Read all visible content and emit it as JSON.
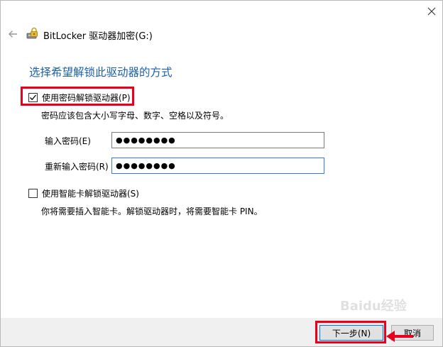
{
  "window": {
    "title": "BitLocker 驱动器加密(G:)"
  },
  "main": {
    "heading": "选择希望解锁此驱动器的方式",
    "password_option": {
      "label": "使用密码解锁驱动器(P)",
      "checked": true,
      "note": "密码应该包含大小写字母、数字、空格以及符号。",
      "enter_label": "输入密码(E)",
      "enter_value": "●●●●●●●●",
      "reenter_label": "重新输入密码(R)",
      "reenter_value": "●●●●●●●●"
    },
    "smartcard_option": {
      "label": "使用智能卡解锁驱动器(S)",
      "checked": false,
      "note": "你将需要插入智能卡。解锁驱动器时，将需要智能卡 PIN。"
    }
  },
  "footer": {
    "next_label": "下一步(N)",
    "cancel_label": "取消"
  },
  "watermark": {
    "text": "Baidu经验"
  },
  "colors": {
    "heading": "#1c5fa9",
    "highlight": "#e8001c",
    "focus_border": "#3a7bd5",
    "footer_bg": "#f0f0f0"
  },
  "icons": [
    "close-icon",
    "back-arrow-icon",
    "bitlocker-drive-icon",
    "checkmark-icon",
    "red-arrow-icon"
  ]
}
